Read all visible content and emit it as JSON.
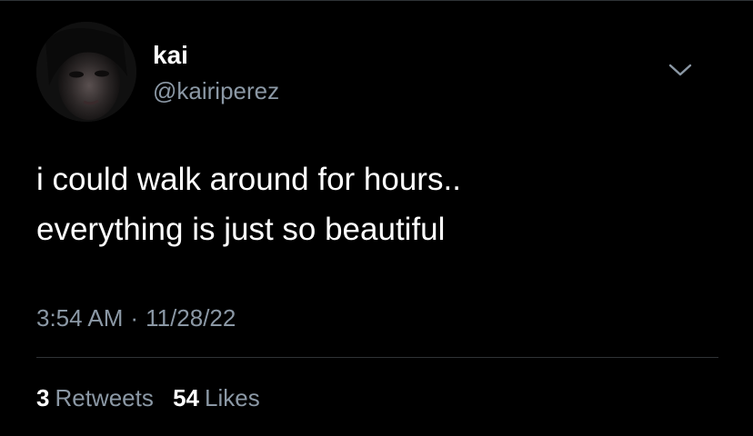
{
  "tweet": {
    "author": {
      "display_name": "kai",
      "handle": "@kairiperez",
      "avatar_icon": "profile-photo"
    },
    "menu_icon": "chevron-down-icon",
    "text_lines": [
      "i could walk around for hours..",
      "everything is just so beautiful"
    ],
    "time": "3:54 AM",
    "separator": "·",
    "date": "11/28/22",
    "stats": {
      "retweets_count": "3",
      "retweets_label": "Retweets",
      "likes_count": "54",
      "likes_label": "Likes"
    }
  },
  "colors": {
    "background": "#000000",
    "primary_text": "#ffffff",
    "secondary_text": "#8b98a5",
    "divider": "#2f3336"
  }
}
